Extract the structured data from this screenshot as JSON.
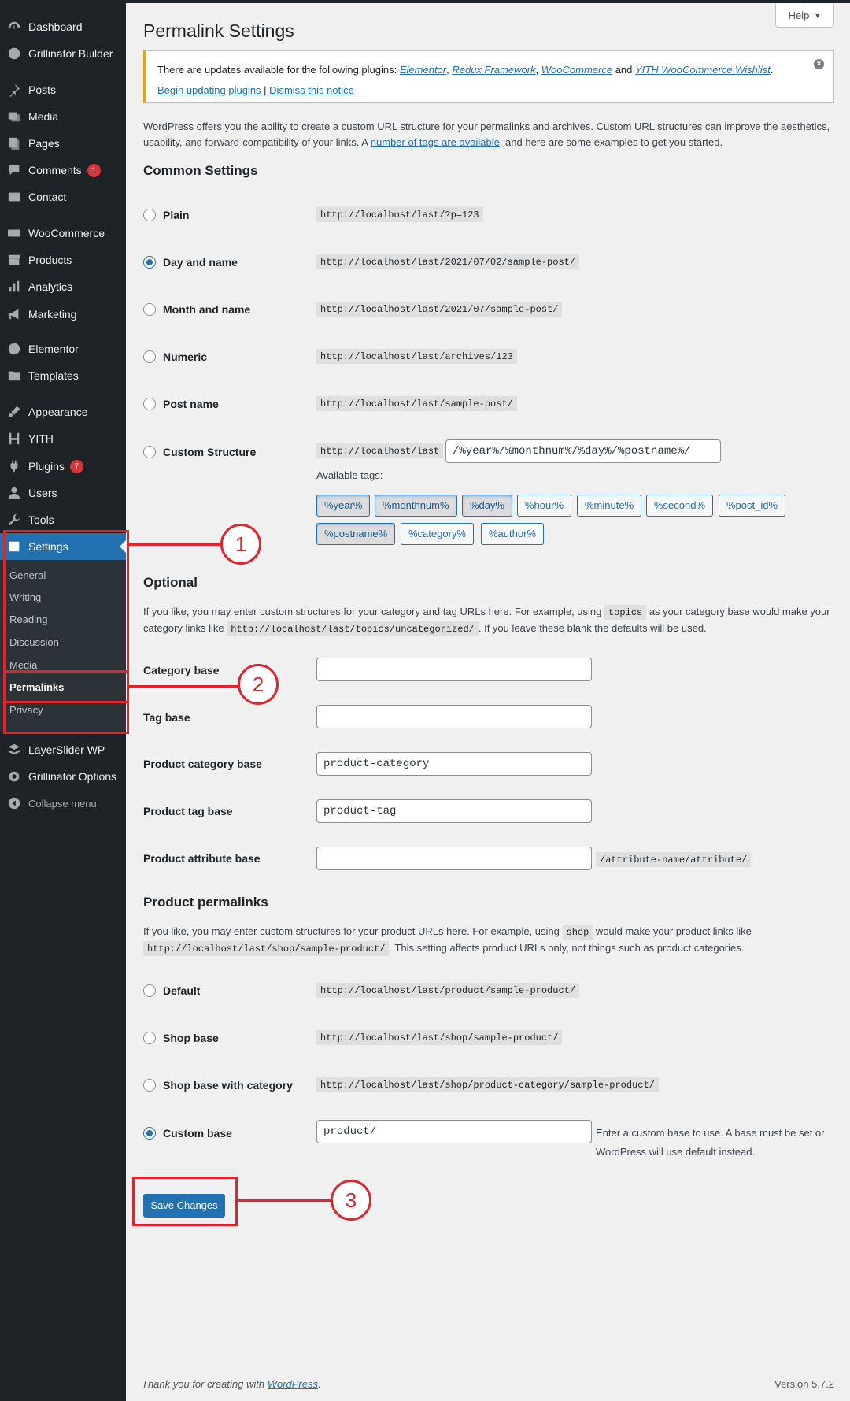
{
  "sidebar": {
    "items": [
      {
        "label": "Dashboard",
        "icon": "dashboard-icon"
      },
      {
        "label": "Grillinator Builder",
        "icon": "globe-icon"
      },
      {
        "label": "Posts",
        "icon": "pin-icon"
      },
      {
        "label": "Media",
        "icon": "media-icon"
      },
      {
        "label": "Pages",
        "icon": "pages-icon"
      },
      {
        "label": "Comments",
        "icon": "comment-icon",
        "badge": "1"
      },
      {
        "label": "Contact",
        "icon": "mail-icon"
      },
      {
        "label": "WooCommerce",
        "icon": "woo-icon"
      },
      {
        "label": "Products",
        "icon": "archive-icon"
      },
      {
        "label": "Analytics",
        "icon": "chart-icon"
      },
      {
        "label": "Marketing",
        "icon": "megaphone-icon"
      },
      {
        "label": "Elementor",
        "icon": "elementor-icon"
      },
      {
        "label": "Templates",
        "icon": "folder-icon"
      },
      {
        "label": "Appearance",
        "icon": "brush-icon"
      },
      {
        "label": "YITH",
        "icon": "yith-icon"
      },
      {
        "label": "Plugins",
        "icon": "plugin-icon",
        "badge": "7"
      },
      {
        "label": "Users",
        "icon": "user-icon"
      },
      {
        "label": "Tools",
        "icon": "wrench-icon"
      },
      {
        "label": "Settings",
        "icon": "settings-icon"
      }
    ],
    "submenu": [
      "General",
      "Writing",
      "Reading",
      "Discussion",
      "Media",
      "Permalinks",
      "Privacy"
    ],
    "after": [
      {
        "label": "LayerSlider WP",
        "icon": "layers-icon"
      },
      {
        "label": "Grillinator Options",
        "icon": "gear-icon"
      },
      {
        "label": "Collapse menu",
        "icon": "collapse-icon"
      }
    ]
  },
  "header": {
    "help_label": "Help",
    "title": "Permalink Settings"
  },
  "notice": {
    "text_prefix": "There are updates available for the following plugins: ",
    "plugin1": "Elementor",
    "sep1": ", ",
    "plugin2": "Redux Framework",
    "sep2": ", ",
    "plugin3": "WooCommerce",
    "and": " and ",
    "plugin4": "YITH WooCommerce Wishlist",
    "period": ".",
    "begin_link": "Begin updating plugins",
    "pipe": " | ",
    "dismiss_link": "Dismiss this notice"
  },
  "intro": {
    "text1": "WordPress offers you the ability to create a custom URL structure for your permalinks and archives. Custom URL structures can improve the aesthetics, usability, and forward-compatibility of your links. A ",
    "link": "number of tags are available",
    "text2": ", and here are some examples to get you started."
  },
  "common": {
    "heading": "Common Settings",
    "options": [
      {
        "label": "Plain",
        "example": "http://localhost/last/?p=123",
        "checked": false
      },
      {
        "label": "Day and name",
        "example": "http://localhost/last/2021/07/02/sample-post/",
        "checked": true
      },
      {
        "label": "Month and name",
        "example": "http://localhost/last/2021/07/sample-post/",
        "checked": false
      },
      {
        "label": "Numeric",
        "example": "http://localhost/last/archives/123",
        "checked": false
      },
      {
        "label": "Post name",
        "example": "http://localhost/last/sample-post/",
        "checked": false
      },
      {
        "label": "Custom Structure",
        "example": "http://localhost/last",
        "checked": false
      }
    ],
    "custom_value": "/%year%/%monthnum%/%day%/%postname%/",
    "available_tags_label": "Available tags:",
    "tags": [
      "%year%",
      "%monthnum%",
      "%day%",
      "%hour%",
      "%minute%",
      "%second%",
      "%post_id%",
      "%postname%",
      "%category%",
      "%author%"
    ]
  },
  "optional": {
    "heading": "Optional",
    "text1": "If you like, you may enter custom structures for your category and tag URLs here. For example, using ",
    "code1": "topics",
    "text2": " as your category base would make your category links like ",
    "code2": "http://localhost/last/topics/uncategorized/",
    "text3": ". If you leave these blank the defaults will be used.",
    "fields": [
      {
        "label": "Category base",
        "value": ""
      },
      {
        "label": "Tag base",
        "value": ""
      },
      {
        "label": "Product category base",
        "value": "product-category"
      },
      {
        "label": "Product tag base",
        "value": "product-tag"
      },
      {
        "label": "Product attribute base",
        "value": ""
      }
    ],
    "attribute_suffix": "/attribute-name/attribute/"
  },
  "product_permalinks": {
    "heading": "Product permalinks",
    "text1": "If you like, you may enter custom structures for your product URLs here. For example, using ",
    "code1": "shop",
    "text2": " would make your product links like ",
    "code2": "http://localhost/last/shop/sample-product/",
    "text3": ". This setting affects product URLs only, not things such as product categories.",
    "options": [
      {
        "label": "Default",
        "example": "http://localhost/last/product/sample-product/",
        "checked": false
      },
      {
        "label": "Shop base",
        "example": "http://localhost/last/shop/sample-product/",
        "checked": false
      },
      {
        "label": "Shop base with category",
        "example": "http://localhost/last/shop/product-category/sample-product/",
        "checked": false
      },
      {
        "label": "Custom base",
        "example": "",
        "checked": true
      }
    ],
    "custom_value": "product/",
    "custom_desc": "Enter a custom base to use. A base must be set or WordPress will use default instead."
  },
  "save_label": "Save Changes",
  "footer": {
    "thanks": "Thank you for creating with ",
    "wp_link": "WordPress",
    "period": ".",
    "version": "Version 5.7.2"
  },
  "annotations": [
    "1",
    "2",
    "3"
  ],
  "colors": {
    "accent": "#2271b1",
    "sidebar": "#1d2327",
    "annotation": "#e2232a",
    "notice_border": "#dba617"
  }
}
